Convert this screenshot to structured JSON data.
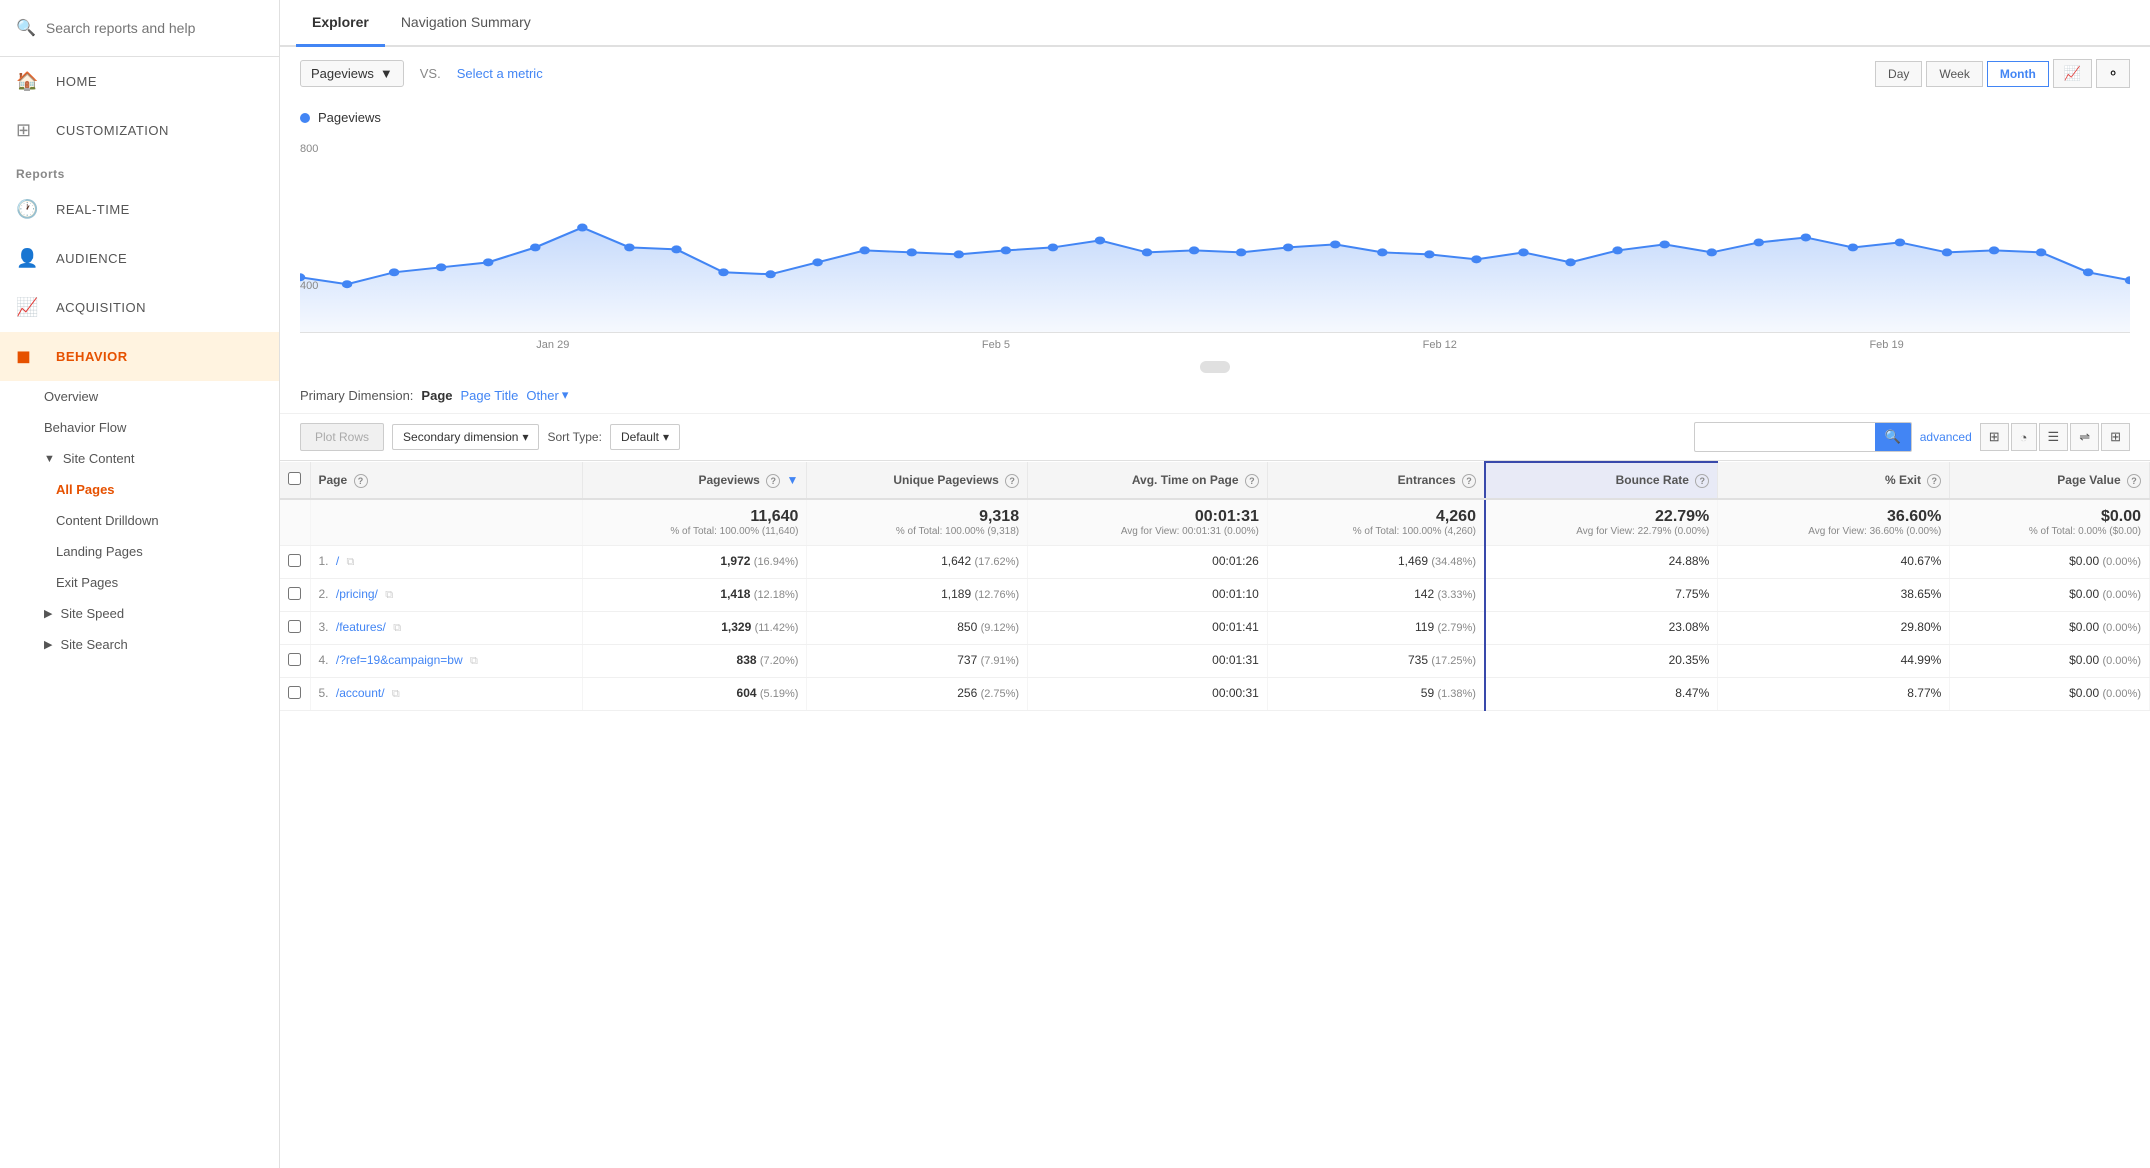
{
  "sidebar": {
    "search_placeholder": "Search reports and help",
    "nav_items": [
      {
        "id": "home",
        "label": "HOME",
        "icon": "🏠"
      },
      {
        "id": "customization",
        "label": "CUSTOMIZATION",
        "icon": "➕"
      }
    ],
    "reports_label": "Reports",
    "report_nav": [
      {
        "id": "real-time",
        "label": "REAL-TIME",
        "icon": "🕐"
      },
      {
        "id": "audience",
        "label": "AUDIENCE",
        "icon": "👤"
      },
      {
        "id": "acquisition",
        "label": "ACQUISITION",
        "icon": "📈"
      },
      {
        "id": "behavior",
        "label": "BEHAVIOR",
        "icon": "🔳",
        "active": true
      }
    ],
    "behavior_sub": [
      {
        "id": "overview",
        "label": "Overview"
      },
      {
        "id": "behavior-flow",
        "label": "Behavior Flow"
      }
    ],
    "site_content": {
      "label": "Site Content",
      "items": [
        {
          "id": "all-pages",
          "label": "All Pages",
          "active": true
        },
        {
          "id": "content-drilldown",
          "label": "Content Drilldown"
        },
        {
          "id": "landing-pages",
          "label": "Landing Pages"
        },
        {
          "id": "exit-pages",
          "label": "Exit Pages"
        }
      ]
    },
    "site_speed": {
      "label": "Site Speed"
    },
    "site_search": {
      "label": "Site Search"
    }
  },
  "tabs": [
    {
      "id": "explorer",
      "label": "Explorer",
      "active": true
    },
    {
      "id": "navigation-summary",
      "label": "Navigation Summary",
      "active": false
    }
  ],
  "metric_bar": {
    "metric_label": "Pageviews",
    "vs_text": "VS.",
    "select_metric_label": "Select a metric"
  },
  "time_buttons": [
    {
      "id": "day",
      "label": "Day"
    },
    {
      "id": "week",
      "label": "Week"
    },
    {
      "id": "month",
      "label": "Month",
      "active": true
    }
  ],
  "chart": {
    "legend_label": "Pageviews",
    "y_label_top": "800",
    "y_label_bottom": "400",
    "x_labels": [
      "Jan 29",
      "Feb 5",
      "Feb 12",
      "Feb 19"
    ],
    "data_points": [
      420,
      390,
      430,
      445,
      460,
      510,
      560,
      490,
      480,
      430,
      420,
      460,
      500,
      490,
      480,
      500,
      510,
      530,
      480,
      510,
      500,
      520,
      530,
      500,
      490,
      480,
      500,
      460,
      430,
      510,
      530,
      500,
      480,
      490,
      530,
      560,
      540,
      520,
      500,
      420
    ]
  },
  "dimension_bar": {
    "primary_label": "Primary Dimension:",
    "page_label": "Page",
    "page_title_label": "Page Title",
    "other_label": "Other"
  },
  "toolbar": {
    "plot_rows_label": "Plot Rows",
    "secondary_dim_label": "Secondary dimension",
    "sort_label": "Sort Type:",
    "sort_default": "Default",
    "advanced_label": "advanced"
  },
  "table": {
    "columns": [
      {
        "id": "page",
        "label": "Page"
      },
      {
        "id": "pageviews",
        "label": "Pageviews",
        "sort": true
      },
      {
        "id": "unique-pageviews",
        "label": "Unique Pageviews"
      },
      {
        "id": "avg-time",
        "label": "Avg. Time on Page"
      },
      {
        "id": "entrances",
        "label": "Entrances"
      },
      {
        "id": "bounce-rate",
        "label": "Bounce Rate",
        "highlight": true
      },
      {
        "id": "pct-exit",
        "label": "% Exit"
      },
      {
        "id": "page-value",
        "label": "Page Value"
      }
    ],
    "totals": {
      "pageviews": "11,640",
      "pageviews_pct": "% of Total: 100.00% (11,640)",
      "unique_pageviews": "9,318",
      "unique_pct": "% of Total: 100.00% (9,318)",
      "avg_time": "00:01:31",
      "avg_time_sub": "Avg for View: 00:01:31 (0.00%)",
      "entrances": "4,260",
      "entrances_pct": "% of Total: 100.00% (4,260)",
      "bounce_rate": "22.79%",
      "bounce_sub": "Avg for View: 22.79% (0.00%)",
      "pct_exit": "36.60%",
      "exit_sub": "Avg for View: 36.60% (0.00%)",
      "page_value": "$0.00",
      "page_value_sub": "% of Total: 0.00% ($0.00)"
    },
    "rows": [
      {
        "num": "1.",
        "page": "/",
        "pageviews": "1,972",
        "pageviews_pct": "(16.94%)",
        "unique": "1,642",
        "unique_pct": "(17.62%)",
        "avg_time": "00:01:26",
        "entrances": "1,469",
        "entrances_pct": "(34.48%)",
        "bounce_rate": "24.88%",
        "pct_exit": "40.67%",
        "page_value": "$0.00",
        "page_value_pct": "(0.00%)"
      },
      {
        "num": "2.",
        "page": "/pricing/",
        "pageviews": "1,418",
        "pageviews_pct": "(12.18%)",
        "unique": "1,189",
        "unique_pct": "(12.76%)",
        "avg_time": "00:01:10",
        "entrances": "142",
        "entrances_pct": "(3.33%)",
        "bounce_rate": "7.75%",
        "pct_exit": "38.65%",
        "page_value": "$0.00",
        "page_value_pct": "(0.00%)"
      },
      {
        "num": "3.",
        "page": "/features/",
        "pageviews": "1,329",
        "pageviews_pct": "(11.42%)",
        "unique": "850",
        "unique_pct": "(9.12%)",
        "avg_time": "00:01:41",
        "entrances": "119",
        "entrances_pct": "(2.79%)",
        "bounce_rate": "23.08%",
        "pct_exit": "29.80%",
        "page_value": "$0.00",
        "page_value_pct": "(0.00%)"
      },
      {
        "num": "4.",
        "page": "/?ref=19&campaign=bw",
        "pageviews": "838",
        "pageviews_pct": "(7.20%)",
        "unique": "737",
        "unique_pct": "(7.91%)",
        "avg_time": "00:01:31",
        "entrances": "735",
        "entrances_pct": "(17.25%)",
        "bounce_rate": "20.35%",
        "pct_exit": "44.99%",
        "page_value": "$0.00",
        "page_value_pct": "(0.00%)"
      },
      {
        "num": "5.",
        "page": "/account/",
        "pageviews": "604",
        "pageviews_pct": "(5.19%)",
        "unique": "256",
        "unique_pct": "(2.75%)",
        "avg_time": "00:00:31",
        "entrances": "59",
        "entrances_pct": "(1.38%)",
        "bounce_rate": "8.47%",
        "pct_exit": "8.77%",
        "page_value": "$0.00",
        "page_value_pct": "(0.00%)"
      }
    ]
  }
}
